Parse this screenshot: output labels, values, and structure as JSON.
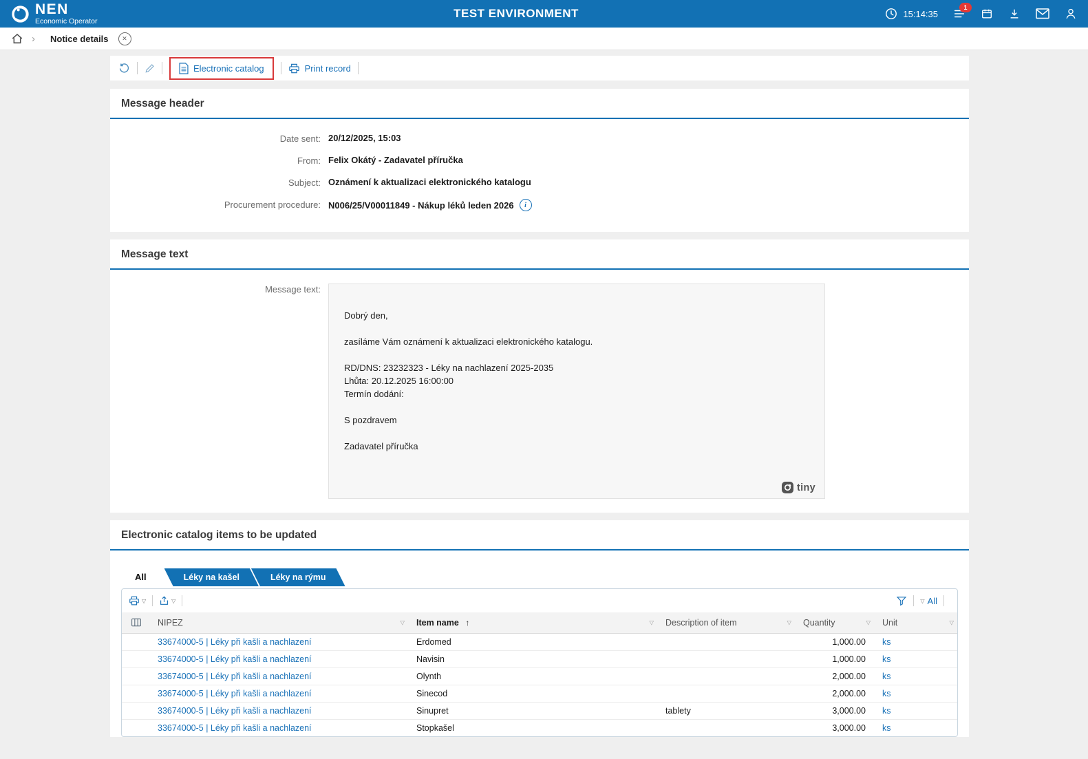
{
  "header": {
    "brand": "NEN",
    "brand_sub": "Economic Operator",
    "title": "TEST ENVIRONMENT",
    "time": "15:14:35",
    "notification_count": "1"
  },
  "breadcrumb": {
    "page": "Notice details"
  },
  "toolbar": {
    "electronic_catalog": "Electronic catalog",
    "print_record": "Print record"
  },
  "message_header": {
    "title": "Message header",
    "fields": [
      {
        "label": "Date sent:",
        "value": "20/12/2025, 15:03"
      },
      {
        "label": "From:",
        "value": "Felix Okátý - Zadavatel příručka"
      },
      {
        "label": "Subject:",
        "value": "Oznámení k aktualizaci elektronického katalogu"
      },
      {
        "label": "Procurement procedure:",
        "value": "N006/25/V00011849 - Nákup léků leden 2026"
      }
    ]
  },
  "message_text": {
    "title": "Message text",
    "label": "Message text:",
    "body": "Dobrý den,\n\nzasíláme Vám oznámení k aktualizaci elektronického katalogu.\n\nRD/DNS: 23232323 - Léky na nachlazení 2025-2035\nLhůta: 20.12.2025 16:00:00\nTermín dodání:\n\nS pozdravem\n\nZadavatel příručka",
    "editor_brand": "tiny"
  },
  "catalog": {
    "title": "Electronic catalog items to be updated",
    "tabs": [
      {
        "label": "All",
        "active": true
      },
      {
        "label": "Léky na kašel",
        "active": false
      },
      {
        "label": "Léky na rýmu",
        "active": false
      }
    ],
    "filter_all": "All",
    "columns": [
      "NIPEZ",
      "Item name",
      "Description of item",
      "Quantity",
      "Unit"
    ],
    "rows": [
      {
        "nipez": "33674000-5 | Léky při kašli a nachlazení",
        "item": "Erdomed",
        "description": "",
        "quantity": "1,000.00",
        "unit": "ks"
      },
      {
        "nipez": "33674000-5 | Léky při kašli a nachlazení",
        "item": "Navisin",
        "description": "",
        "quantity": "1,000.00",
        "unit": "ks"
      },
      {
        "nipez": "33674000-5 | Léky při kašli a nachlazení",
        "item": "Olynth",
        "description": "",
        "quantity": "2,000.00",
        "unit": "ks"
      },
      {
        "nipez": "33674000-5 | Léky při kašli a nachlazení",
        "item": "Sinecod",
        "description": "",
        "quantity": "2,000.00",
        "unit": "ks"
      },
      {
        "nipez": "33674000-5 | Léky při kašli a nachlazení",
        "item": "Sinupret",
        "description": "tablety",
        "quantity": "3,000.00",
        "unit": "ks"
      },
      {
        "nipez": "33674000-5 | Léky při kašli a nachlazení",
        "item": "Stopkašel",
        "description": "",
        "quantity": "3,000.00",
        "unit": "ks"
      }
    ]
  },
  "colors": {
    "header_blue": "#1271b4",
    "link_blue": "#1a72b8",
    "tab_blue": "#1271b4",
    "highlight_red": "#d8393a",
    "badge_red": "#e53935"
  }
}
